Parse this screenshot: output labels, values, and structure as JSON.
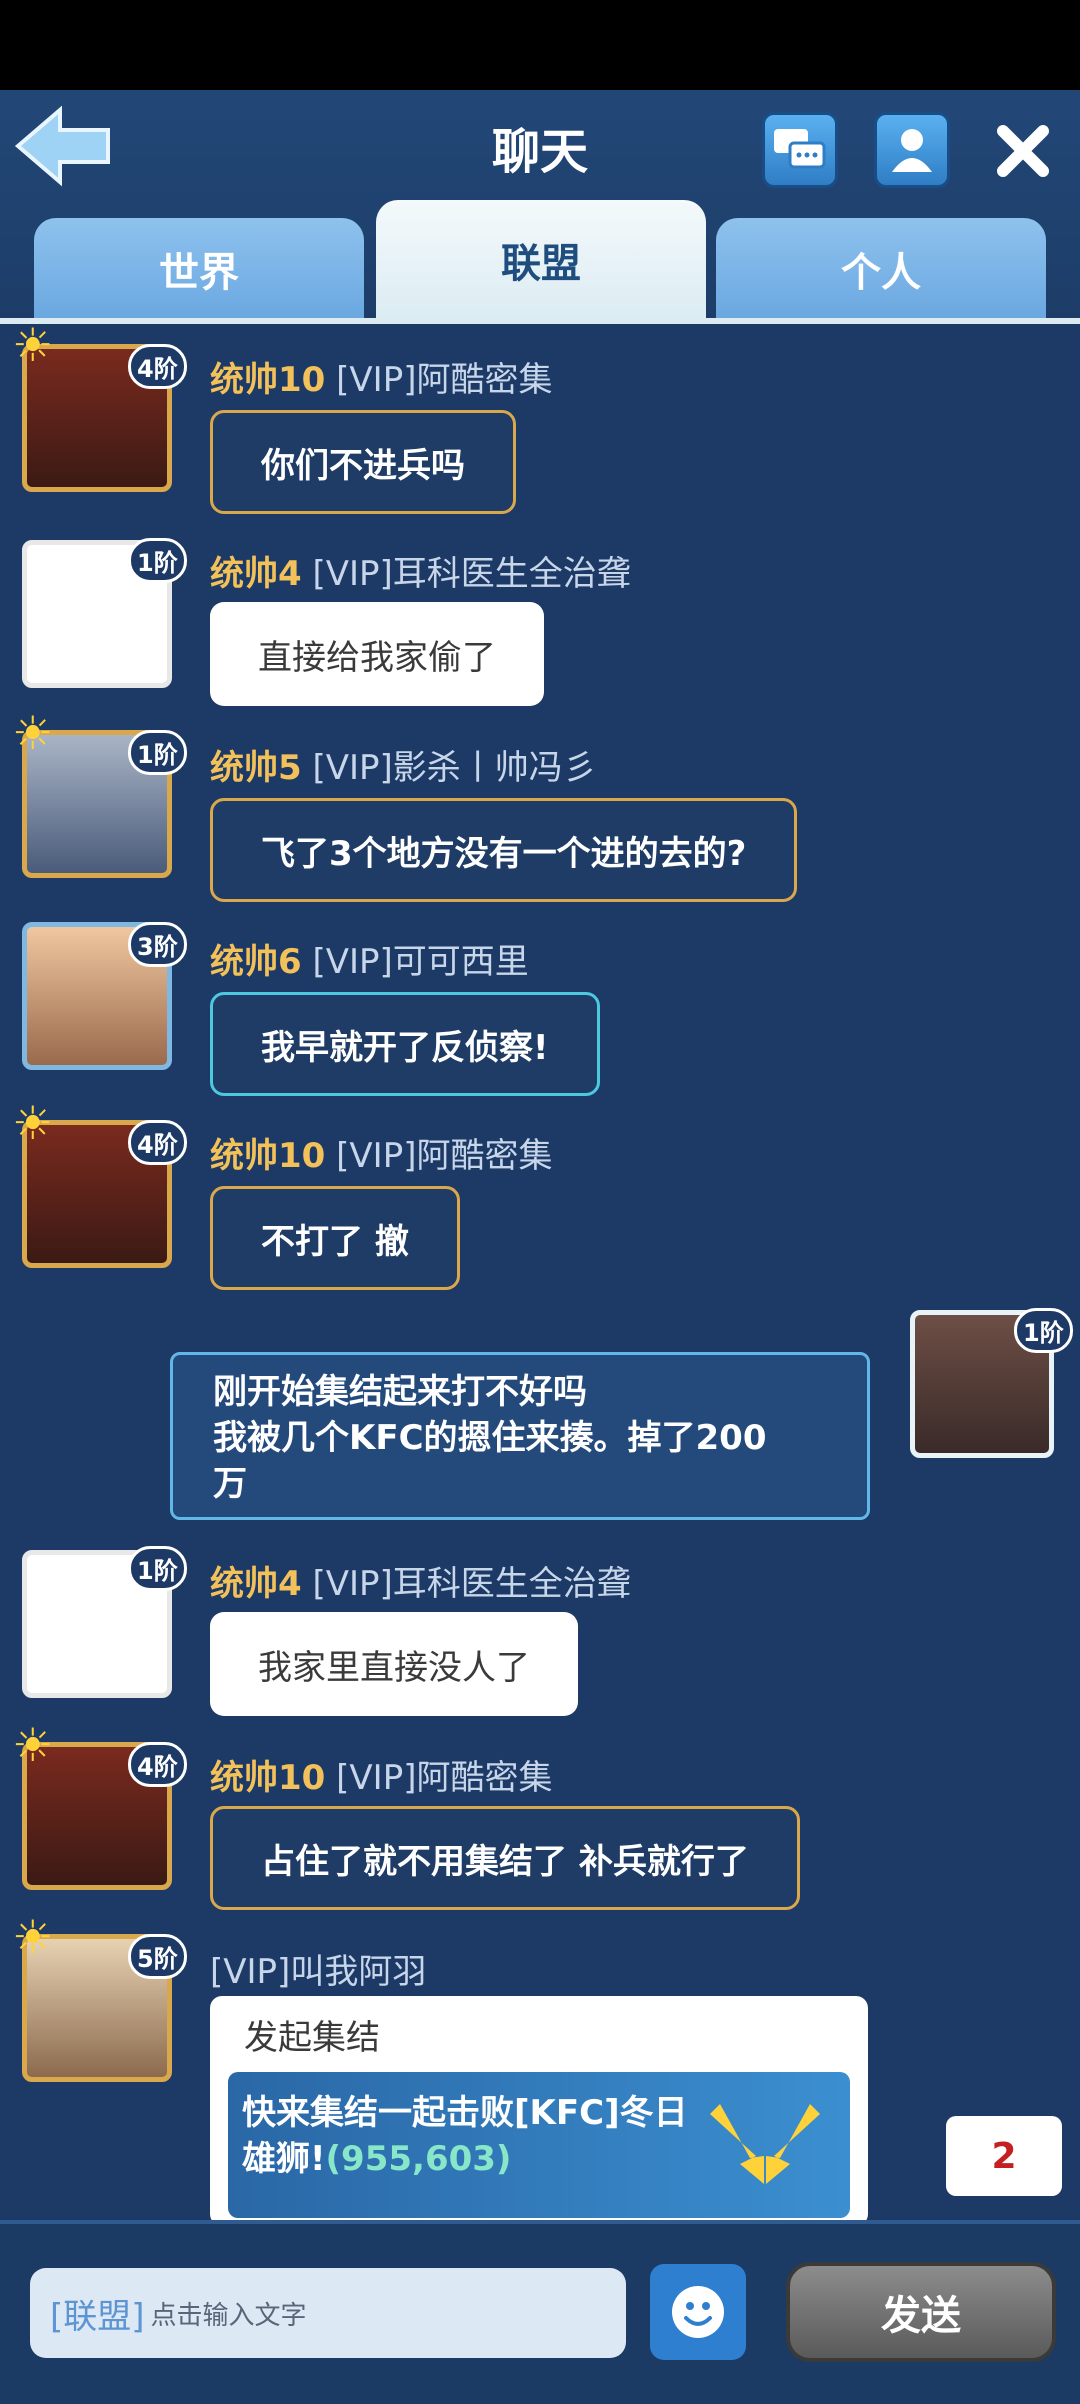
{
  "header": {
    "title": "聊天"
  },
  "tabs": [
    {
      "label": "世界"
    },
    {
      "label": "联盟"
    },
    {
      "label": "个人"
    }
  ],
  "messages": [
    {
      "level": "统帅10",
      "name": "[VIP]阿酷密集",
      "text": "你们不进兵吗",
      "rank": "4阶",
      "style": "gold"
    },
    {
      "level": "统帅4",
      "name": "[VIP]耳科医生全治聋",
      "text": "直接给我家偷了",
      "rank": "1阶",
      "style": "white"
    },
    {
      "level": "统帅5",
      "name": "[VIP]影杀丨帅冯彡",
      "text": "飞了3个地方没有一个进的去的?",
      "rank": "1阶",
      "style": "gold"
    },
    {
      "level": "统帅6",
      "name": "[VIP]可可西里",
      "text": "我早就开了反侦察!",
      "rank": "3阶",
      "style": "cyan"
    },
    {
      "level": "统帅10",
      "name": "[VIP]阿酷密集",
      "text": "不打了 撤",
      "rank": "4阶",
      "style": "gold"
    },
    {
      "level": "统帅4",
      "name": "[VIP]耳科医生全治聋",
      "text": "我家里直接没人了",
      "rank": "1阶",
      "style": "white"
    },
    {
      "level": "统帅10",
      "name": "[VIP]阿酷密集",
      "text": "占住了就不用集结了 补兵就行了",
      "rank": "4阶",
      "style": "gold"
    }
  ],
  "self_message": {
    "lines": [
      "刚开始集结起来打不好吗",
      "我被几个KFC的摁住来揍。掉了200",
      "万"
    ],
    "rank": "1阶"
  },
  "rally": {
    "name": "[VIP]叫我阿羽",
    "rank": "5阶",
    "title": "发起集结",
    "text": "快来集结一起击败[KFC]冬日雄狮!",
    "coords": "(955,603)"
  },
  "unread_badge": "2",
  "input": {
    "channel_tag": "[联盟]",
    "placeholder": "点击输入文字"
  },
  "send_label": "发送",
  "colors": {
    "background": "#1d3a66",
    "gold": "#f3c15a",
    "accent": "#2f7fd0"
  }
}
